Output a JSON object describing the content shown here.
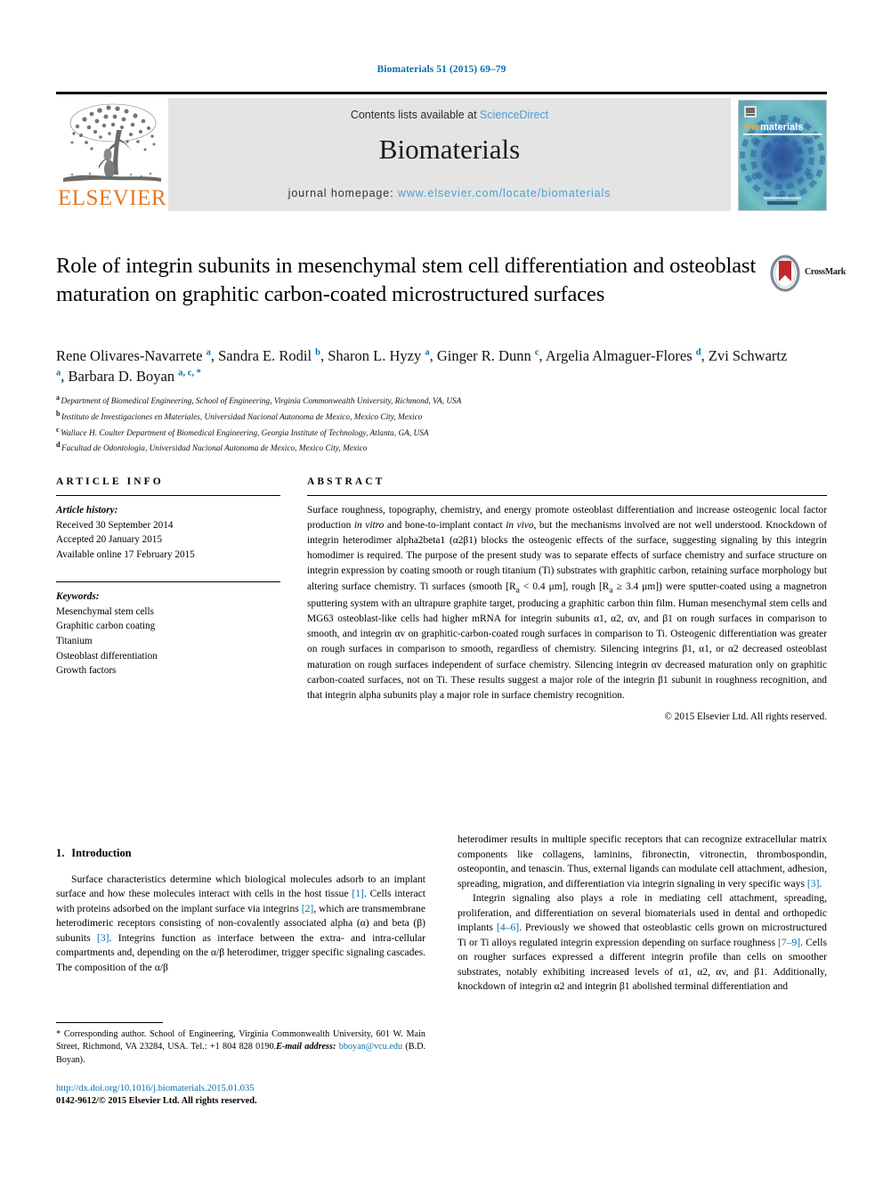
{
  "running_head": "Biomaterials 51 (2015) 69–79",
  "masthead": {
    "publisher_logo_text": "ELSEVIER",
    "contents_prefix": "Contents lists available at ",
    "contents_link": "ScienceDirect",
    "journal_name": "Biomaterials",
    "homepage_prefix": "journal homepage: ",
    "homepage_url": "www.elsevier.com/locate/biomaterials",
    "cover_title_part1": "Bio",
    "cover_title_part2": "materials",
    "colors": {
      "band_background": "#e4e4e4",
      "link_blue": "#4a9fd4",
      "elsevier_orange": "#e87722",
      "running_head_blue": "#0a6ea8",
      "cover_teal": "#5fb4bd",
      "cover_navy": "#2f5d9e"
    }
  },
  "crossmark": {
    "label": "CrossMark"
  },
  "article": {
    "title": "Role of integrin subunits in mesenchymal stem cell differentiation and osteoblast maturation on graphitic carbon-coated microstructured surfaces",
    "authors": [
      {
        "name": "Rene Olivares-Navarrete",
        "marks": "a",
        "sep": ", "
      },
      {
        "name": "Sandra E. Rodil",
        "marks": "b",
        "sep": ", "
      },
      {
        "name": "Sharon L. Hyzy",
        "marks": "a",
        "sep": ", "
      },
      {
        "name": "Ginger R. Dunn",
        "marks": "c",
        "sep": ", "
      },
      {
        "name": "Argelia Almaguer-Flores",
        "marks": "d",
        "sep": ", "
      },
      {
        "name": "Zvi Schwartz",
        "marks": "a",
        "sep": ", "
      },
      {
        "name": "Barbara D. Boyan",
        "marks": "a, c, *",
        "sep": ""
      }
    ],
    "affiliations": [
      {
        "label": "a",
        "text": "Department of Biomedical Engineering, School of Engineering, Virginia Commonwealth University, Richmond, VA, USA"
      },
      {
        "label": "b",
        "text": "Instituto de Investigaciones en Materiales, Universidad Nacional Autonoma de Mexico, Mexico City, Mexico"
      },
      {
        "label": "c",
        "text": "Wallace H. Coulter Department of Biomedical Engineering, Georgia Institute of Technology, Atlanta, GA, USA"
      },
      {
        "label": "d",
        "text": "Facultad de Odontologia, Universidad Nacional Autonoma de Mexico, Mexico City, Mexico"
      }
    ]
  },
  "article_info": {
    "heading": "ARTICLE INFO",
    "history_title": "Article history:",
    "history": [
      "Received 30 September 2014",
      "Accepted 20 January 2015",
      "Available online 17 February 2015"
    ],
    "keywords_title": "Keywords:",
    "keywords": [
      "Mesenchymal stem cells",
      "Graphitic carbon coating",
      "Titanium",
      "Osteoblast differentiation",
      "Growth factors"
    ]
  },
  "abstract": {
    "heading": "ABSTRACT",
    "paragraph_parts": [
      {
        "t": "Surface roughness, topography, chemistry, and energy promote osteoblast differentiation and increase osteogenic local factor production "
      },
      {
        "t": "in vitro",
        "i": true
      },
      {
        "t": " and bone-to-implant contact "
      },
      {
        "t": "in vivo",
        "i": true
      },
      {
        "t": ", but the mechanisms involved are not well understood. Knockdown of integrin heterodimer alpha2beta1 (α2β1) blocks the osteogenic effects of the surface, suggesting signaling by this integrin homodimer is required. The purpose of the present study was to separate effects of surface chemistry and surface structure on integrin expression by coating smooth or rough titanium (Ti) substrates with graphitic carbon, retaining surface morphology but altering surface chemistry. Ti surfaces (smooth [R"
      },
      {
        "t": "a",
        "sub": true
      },
      {
        "t": " < 0.4 μm], rough [R"
      },
      {
        "t": "a",
        "sub": true
      },
      {
        "t": " ≥ 3.4 μm]) were sputter-coated using a magnetron sputtering system with an ultrapure graphite target, producing a graphitic carbon thin film. Human mesenchymal stem cells and MG63 osteoblast-like cells had higher mRNA for integrin subunits α1, α2, αv, and β1 on rough surfaces in comparison to smooth, and integrin αv on graphitic-carbon-coated rough surfaces in comparison to Ti. Osteogenic differentiation was greater on rough surfaces in comparison to smooth, regardless of chemistry. Silencing integrins β1, α1, or α2 decreased osteoblast maturation on rough surfaces independent of surface chemistry. Silencing integrin αv decreased maturation only on graphitic carbon-coated surfaces, not on Ti. These results suggest a major role of the integrin β1 subunit in roughness recognition, and that integrin alpha subunits play a major role in surface chemistry recognition."
      }
    ],
    "copyright": "© 2015 Elsevier Ltd. All rights reserved."
  },
  "introduction": {
    "number": "1.",
    "title": "Introduction",
    "left_paragraph_parts": [
      {
        "t": "Surface characteristics determine which biological molecules adsorb to an implant surface and how these molecules interact with cells in the host tissue "
      },
      {
        "t": "[1]",
        "ref": true
      },
      {
        "t": ". Cells interact with proteins adsorbed on the implant surface via integrins "
      },
      {
        "t": "[2]",
        "ref": true
      },
      {
        "t": ", which are transmembrane heterodimeric receptors consisting of non-covalently associated alpha (α) and beta (β) subunits "
      },
      {
        "t": "[3]",
        "ref": true
      },
      {
        "t": ". Integrins function as interface between the extra- and intra-cellular compartments and, depending on the α/β heterodimer, trigger specific signaling cascades. The composition of the α/β"
      }
    ],
    "right_paragraph1_parts": [
      {
        "t": "heterodimer results in multiple specific receptors that can recognize extracellular matrix components like collagens, laminins, fibronectin, vitronectin, thrombospondin, osteopontin, and tenascin. Thus, external ligands can modulate cell attachment, adhesion, spreading, migration, and differentiation via integrin signaling in very specific ways "
      },
      {
        "t": "[3]",
        "ref": true
      },
      {
        "t": "."
      }
    ],
    "right_paragraph2_parts": [
      {
        "t": "Integrin signaling also plays a role in mediating cell attachment, spreading, proliferation, and differentiation on several biomaterials used in dental and orthopedic implants "
      },
      {
        "t": "[4–6]",
        "ref": true
      },
      {
        "t": ". Previously we showed that osteoblastic cells grown on microstructured Ti or Ti alloys regulated integrin expression depending on surface roughness "
      },
      {
        "t": "[7–9]",
        "ref": true
      },
      {
        "t": ". Cells on rougher surfaces expressed a different integrin profile than cells on smoother substrates, notably exhibiting increased levels of α1, α2, αv, and β1. Additionally, knockdown of integrin α2 and integrin β1 abolished terminal differentiation and"
      }
    ]
  },
  "footnote": {
    "parts": [
      {
        "t": "* Corresponding author. School of Engineering, Virginia Commonwealth University, 601 W. Main Street, Richmond, VA 23284, USA. Tel.: +1 804 828 0190."
      },
      {
        "t": "E-mail address:",
        "emlbl": true
      },
      {
        "t": " "
      },
      {
        "t": "bboyan@vcu.edu",
        "link": true
      },
      {
        "t": " (B.D. Boyan)."
      }
    ]
  },
  "footer": {
    "doi": "http://dx.doi.org/10.1016/j.biomaterials.2015.01.035",
    "issn_line": "0142-9612/© 2015 Elsevier Ltd. All rights reserved."
  }
}
